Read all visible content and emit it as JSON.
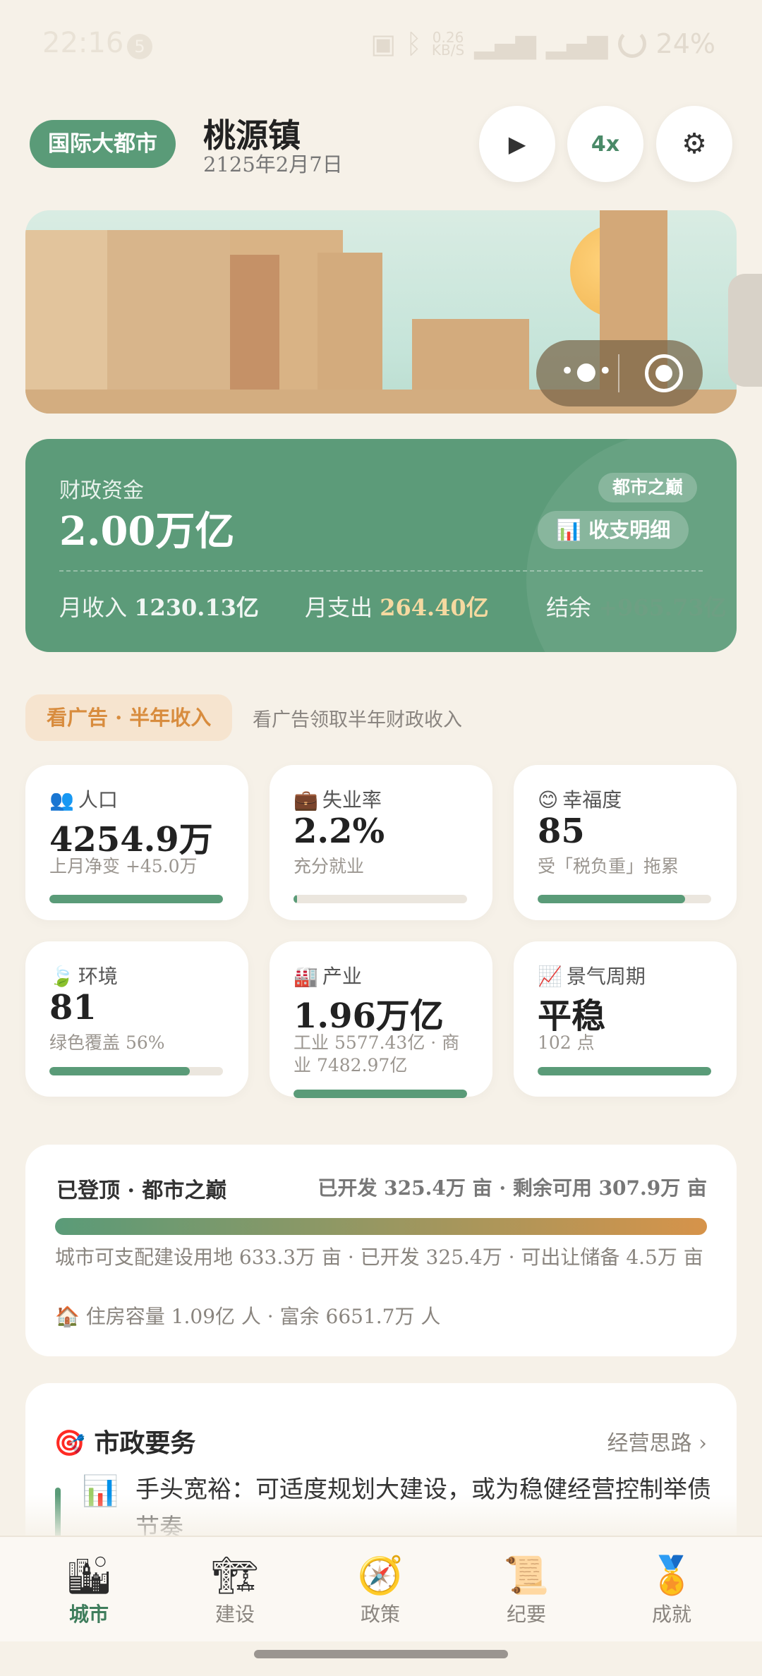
{
  "status_bar": {
    "time": "22:16",
    "notification_count": "5",
    "net_speed_value": "0.26",
    "net_speed_unit": "KB/S",
    "battery": "24%"
  },
  "header": {
    "tier_badge": "国际大都市",
    "town_name": "桃源镇",
    "date": "2125年2月7日",
    "speed_label": "4x"
  },
  "finance": {
    "label": "财政资金",
    "amount": "2.00万亿",
    "peak_badge": "都市之巅",
    "detail_button": "收支明细",
    "income_label": "月收入",
    "income_value": "1230.13亿",
    "expense_label": "月支出",
    "expense_value": "264.40亿",
    "balance_label": "结余",
    "balance_value": "+965.73亿"
  },
  "ad": {
    "button": "看广告 · 半年收入",
    "text": "看广告领取半年财政收入"
  },
  "stats": [
    {
      "icon": "👥",
      "title": "人口",
      "value": "4254.9万",
      "sub": "上月净变 +45.0万",
      "level": 1.0
    },
    {
      "icon": "💼",
      "title": "失业率",
      "value": "2.2%",
      "sub": "充分就业",
      "level": 0.022
    },
    {
      "icon": "😊",
      "title": "幸福度",
      "value": "85",
      "sub": "受「税负重」拖累",
      "level": 0.85
    },
    {
      "icon": "🍃",
      "title": "环境",
      "value": "81",
      "sub": "绿色覆盖 56%",
      "level": 0.81
    },
    {
      "icon": "🏭",
      "title": "产业",
      "value": "1.96万亿",
      "sub": "工业 5577.43亿 · 商业 7482.97亿",
      "level": 1.0
    },
    {
      "icon": "📈",
      "title": "景气周期",
      "value": "平稳",
      "sub": "102 点",
      "level": 1.0
    }
  ],
  "land": {
    "title": "已登顶 · 都市之巅",
    "summary": "已开发 325.4万 亩 · 剩余可用 307.9万 亩",
    "detail": "城市可支配建设用地 633.3万 亩 · 已开发 325.4万 · 可出让储备 4.5万 亩",
    "housing": "🏠 住房容量 1.09亿 人 · 富余 6651.7万 人"
  },
  "tasks": {
    "title": "🎯 市政要务",
    "link": "经营思路 ›",
    "item": "手头宽裕：可适度规划大建设，或为稳健经营控制举债节奏"
  },
  "nav": [
    {
      "icon": "🏙",
      "label": "城市"
    },
    {
      "icon": "🏗",
      "label": "建设"
    },
    {
      "icon": "🧭",
      "label": "政策"
    },
    {
      "icon": "📜",
      "label": "纪要"
    },
    {
      "icon": "🏅",
      "label": "成就"
    }
  ]
}
